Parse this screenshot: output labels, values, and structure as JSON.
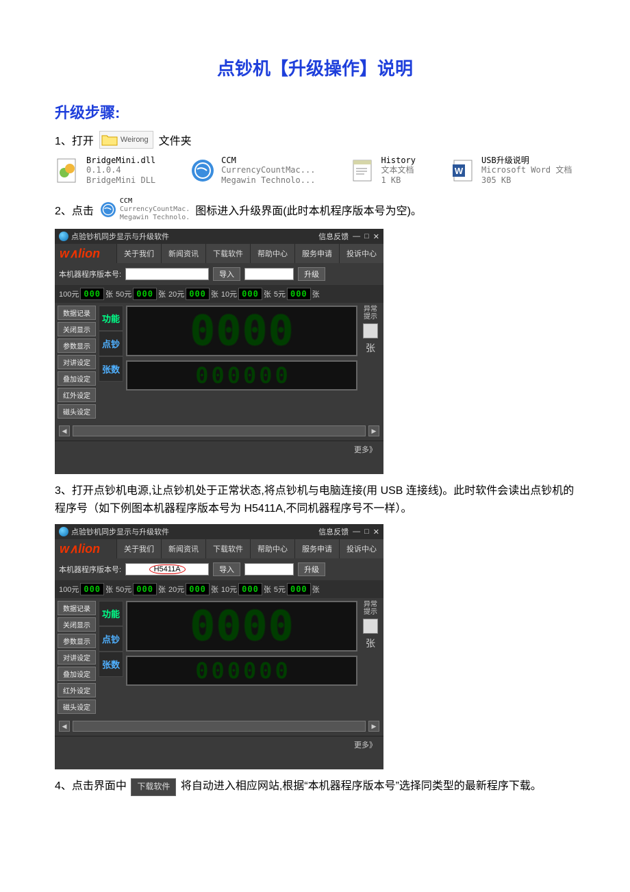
{
  "doc": {
    "title": "点钞机【升级操作】说明",
    "subtitle": "升级步骤:",
    "step1_prefix": "1、打开",
    "step1_suffix": "文件夹",
    "folder_label": "Weirong",
    "files": [
      {
        "name": "BridgeMini.dll",
        "line2": "0.1.0.4",
        "line3": "BridgeMini DLL"
      },
      {
        "name": "CCM",
        "line2": "CurrencyCountMac...",
        "line3": "Megawin Technolo..."
      },
      {
        "name": "History",
        "line2": "文本文档",
        "line3": "1 KB"
      },
      {
        "name": "USB升级说明",
        "line2": "Microsoft Word 文档",
        "line3": "305 KB"
      }
    ],
    "step2_prefix": "2、点击",
    "step2_suffix": " 图标进入升级界面(此时本机程序版本号为空)。",
    "ccm_inline": {
      "name": "CCM",
      "line2": "CurrencyCountMac.",
      "line3": "Megawin Technolo."
    },
    "step3": "3、打开点钞机电源,让点钞机处于正常状态,将点钞机与电脑连接(用 USB 连接线)。此时软件会读出点钞机的程序号（如下例图本机器程序版本号为 H5411A,不同机器程序号不一样）。",
    "step4_prefix": "4、点击界面中",
    "step4_btn": "下载软件",
    "step4_suffix": "将自动进入相应网站,根据“本机器程序版本号”选择同类型的最新程序下载。"
  },
  "app": {
    "title": "点验钞机同步显示与升级软件",
    "feedback": "信息反馈",
    "tabs": [
      "关于我们",
      "新闻资讯",
      "下载软件",
      "帮助中心",
      "服务申请",
      "投诉中心"
    ],
    "ver_label": "本机器程序版本号:",
    "ver_value_1": "",
    "ver_value_2": "H5411A",
    "import_btn": "导入",
    "upgrade_btn": "升级",
    "denoms": [
      {
        "l": "100元",
        "v": "000",
        "u": "张"
      },
      {
        "l": "50元",
        "v": "000",
        "u": "张"
      },
      {
        "l": "20元",
        "v": "000",
        "u": "张"
      },
      {
        "l": "10元",
        "v": "000",
        "u": "张"
      },
      {
        "l": "5元",
        "v": "000",
        "u": "张"
      }
    ],
    "side": [
      "数据记录",
      "关闭显示",
      "参数显示",
      "对讲设定",
      "叠加设定",
      "红外设定",
      "磁头设定"
    ],
    "mid1": "功能",
    "mid2": "点钞",
    "mid3": "张数",
    "bigdigits": "0000",
    "smalldigits": "000000",
    "warn": "异常\n提示",
    "unit": "张",
    "more": "更多》"
  }
}
